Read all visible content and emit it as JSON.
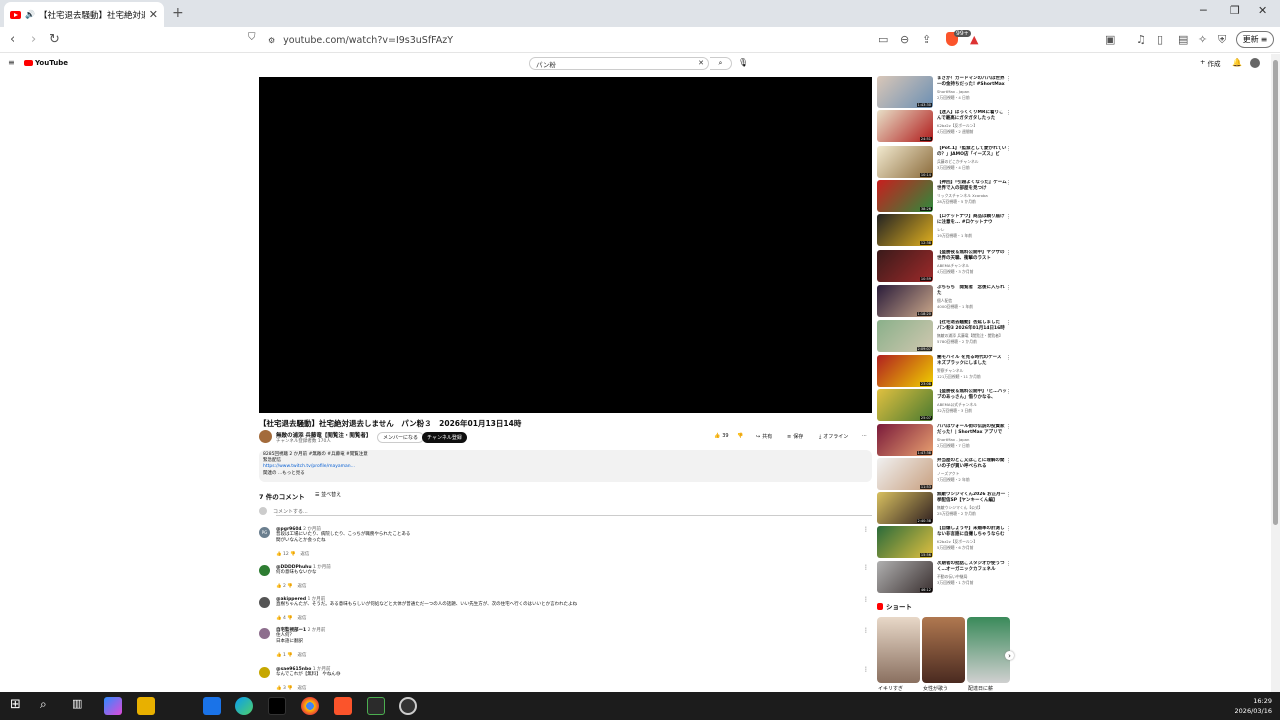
{
  "browser": {
    "tab_title": "【社宅退去騒動】社宅絶対退去",
    "url": "youtube.com/watch?v=I9s3uSfFAzY",
    "update_label": "更新"
  },
  "yt": {
    "logo": "YouTube",
    "search_value": "パン粉",
    "create": "作成"
  },
  "video": {
    "title": "【社宅退去騒動】社宅絶対退去しません　パン粉３　2026年01月13日14時",
    "channel": "無敵の浦添 兵藤竜【閲覧注・閲覧者】",
    "subs": "チャンネル登録者数 170人",
    "member_btn": "メンバーになる",
    "subscribe_btn": "チャンネル登録",
    "likes": "39",
    "share": "共有",
    "save": "保存",
    "offline": "オフライン",
    "desc_line1": "8285回視聴  2 か月前  #無敵の #兵藤竜 #閲覧注意",
    "desc_line2": "緊急配信",
    "desc_link": "https://www.twitch.tv/profile/mayaman...",
    "desc_more": "関連の ...もっと見る"
  },
  "comments": {
    "count_label": "7 件のコメント",
    "sort_label": "並べ替え",
    "add_placeholder": "コメントする...",
    "items": [
      {
        "initial": "PG",
        "author": "@pgr9604",
        "time": "2 か月前",
        "line1": "普段は工場にいたり、病院したり、こっちが職務やられたことある",
        "line2": "間がいなんとか会ったね",
        "likes": "12"
      },
      {
        "initial": "",
        "author": "@DDDDPhuhu",
        "time": "1 か月前",
        "line1": "何の意味もないかな",
        "line2": "",
        "likes": "2"
      },
      {
        "initial": "",
        "author": "@akippered",
        "time": "1 か月前",
        "line1": "直樹ちゃんたが、そうだ。ある意味もらしいが何処などと大体が普通ただ一つの人の話題、いい先生方が、次の住宅へ行くのはいいとか言われたよね",
        "line2": "",
        "likes": "4"
      },
      {
        "initial": "",
        "author": "自宅監視部ー1",
        "time": "2 か月前",
        "line1": "住人何？",
        "line2": "日本語に翻訳",
        "likes": "1"
      },
      {
        "initial": "",
        "author": "@sae9615nbo",
        "time": "1 か月前",
        "line1": "なんでこれが【無料】 やねん😅",
        "line2": "",
        "likes": "3"
      }
    ],
    "reply": "返信"
  },
  "recommendations": [
    {
      "title": "まさか！ガードマンのパパは世界一の金持ちだった! #ShortMax",
      "channel": "ShortMax - Japan",
      "meta": "2万回視聴・4 日前",
      "dur": "1:43:30"
    },
    {
      "title": "【迷入】ぼっくくりMRに着りこんで最高にガタガタしたった",
      "channel": "K2bz2z【反ボールン】",
      "meta": "4万回視聴・2 週間前",
      "dur": "24:51"
    },
    {
      "title": "【Pot.1】「監禁として愛かれていの？」JAMO店「イーズス」ビ",
      "channel": "兵藤のどこかチャンネル",
      "meta": "3万回視聴・4 日前",
      "dur": "10:14"
    },
    {
      "title": "【神回】『引越よくなった』ゲーム世界で入の部屋を見つけ",
      "channel": "リックスチャンネル Xcoroba",
      "meta": "28万回視聴・5 か月前",
      "dur": "38:26"
    },
    {
      "title": "【ロケットナウ】商品は頼り届けに注意を... #ロケットナウ",
      "channel": "レレ",
      "meta": "19万回視聴・1 年前",
      "dur": "12:38"
    },
    {
      "title": "【盛勝夜＆無料公開中】ヤクザの世界の天職、衝撃のラスト",
      "channel": "ABEMAチャンネル",
      "meta": "4万回視聴・3 か月前",
      "dur": "10:59"
    },
    {
      "title": "ぶちらち　閲覧者　念後に入られた",
      "channel": "個人配信",
      "meta": "4000回視聴・1 年前",
      "dur": "1:18:20"
    },
    {
      "title": "【社宅退去騒動】杏延しました　パン粉3 2026年01月14日16時",
      "channel": "無敵の浦添 兵藤竜【閲覧注・閲覧者】",
      "meta": "5780回視聴・2 か月前",
      "dur": "2:09:07"
    },
    {
      "title": "闇モバイル を見る時代のケース ネズブラックにしました",
      "channel": "警察チャンネル",
      "meta": "121万回視聴・11 か月前",
      "dur": "23:08"
    },
    {
      "title": "【盛勝夜＆無料公開中】「ビ…バッブのあっさん」借りかなる、",
      "channel": "ABEMA公式チャンネル",
      "meta": "32万回視聴・3 日前",
      "dur": "25:07"
    },
    {
      "title": "パパはウォール街の伝説の投資家だった！| ShortMax アプリで",
      "channel": "ShortMax - Japan",
      "meta": "2万回視聴・7 日前",
      "dur": "1:47:38"
    },
    {
      "title": "弁当屋のどこ又はことに理解の間いの子が買い呼べられる",
      "channel": "ノーズアクト",
      "meta": "7万回視聴・2 年前",
      "dur": "11:53"
    },
    {
      "title": "無敵ウシジマくん2026 お正月一挙配信SP【ヤンキーくん編】",
      "channel": "無敵ウシジマくん【公式】",
      "meta": "25万回視聴・2 か月前",
      "dur": "2:40:38"
    },
    {
      "title": "【自爆しょうや】未婚率の計測しない非言語に自撮しちゃうならむ",
      "channel": "K2bz2z【反ボールン】",
      "meta": "5万回視聴・6 か月前",
      "dur": "15:56"
    },
    {
      "title": "次期者の批話ごスタジオが使うつく…オーガニックカフェネル",
      "channel": "不動の伝い中継局",
      "meta": "3万回視聴・1 か月前",
      "dur": "46:12"
    }
  ],
  "shorts": {
    "header": "ショート",
    "items": [
      {
        "title": "イキリすぎ"
      },
      {
        "title": "女性が歌う"
      },
      {
        "title": "配達日に薪"
      }
    ]
  },
  "taskbar": {
    "time": "16:29",
    "date": "2026/03/16"
  }
}
